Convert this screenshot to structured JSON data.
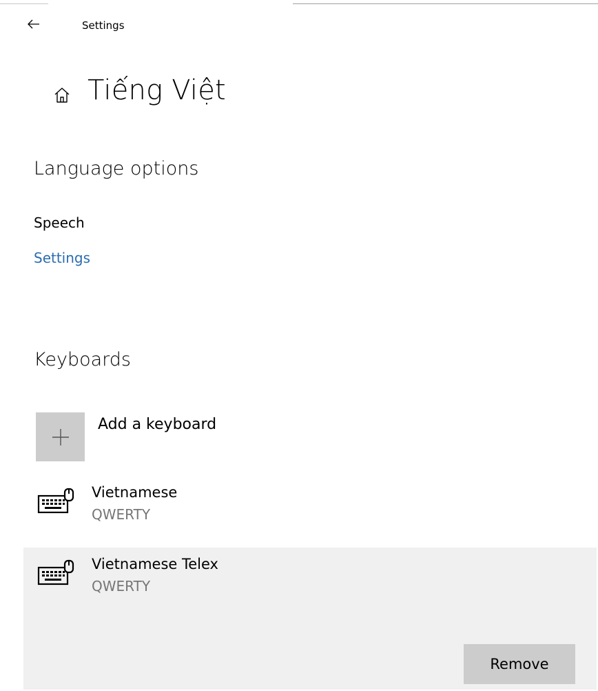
{
  "header": {
    "window_title": "Settings"
  },
  "page": {
    "title": "Tiếng Việt"
  },
  "language_options": {
    "heading": "Language options",
    "speech_label": "Speech",
    "settings_link": "Settings"
  },
  "keyboards": {
    "heading": "Keyboards",
    "add_label": "Add a keyboard",
    "items": [
      {
        "name": "Vietnamese",
        "layout": "QWERTY"
      },
      {
        "name": "Vietnamese Telex",
        "layout": "QWERTY",
        "selected": true
      }
    ],
    "remove_label": "Remove"
  },
  "icons": {
    "back": "arrow-left-icon",
    "home": "home-icon",
    "add": "plus-icon",
    "keyboard": "keyboard-icon"
  },
  "colors": {
    "link": "#2b6cb0",
    "tile": "#cccccc",
    "selected_row": "#f0f0f0",
    "secondary_text": "#767676"
  }
}
